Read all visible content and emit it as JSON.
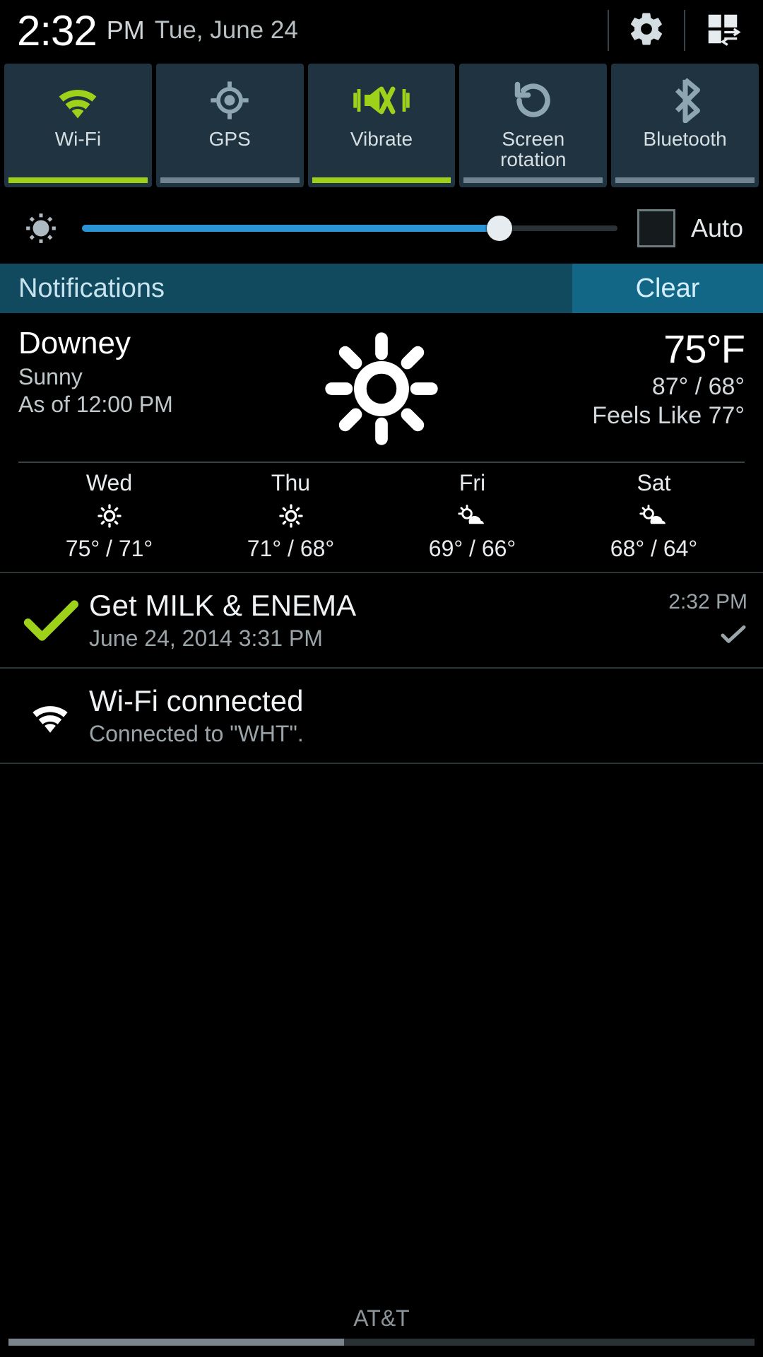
{
  "status": {
    "time": "2:32",
    "ampm": "PM",
    "date": "Tue, June 24"
  },
  "toggles": [
    {
      "label": "Wi-Fi",
      "active": true
    },
    {
      "label": "GPS",
      "active": false
    },
    {
      "label": "Vibrate",
      "active": true
    },
    {
      "label": "Screen\nrotation",
      "active": false
    },
    {
      "label": "Bluetooth",
      "active": false
    }
  ],
  "brightness": {
    "percent": 78,
    "auto_label": "Auto",
    "auto_checked": false
  },
  "notif_header": {
    "title": "Notifications",
    "clear": "Clear"
  },
  "weather": {
    "city": "Downey",
    "condition": "Sunny",
    "asof": "As of 12:00 PM",
    "temp": "75°F",
    "hilo": "87° / 68°",
    "feels": "Feels Like 77°",
    "forecast": [
      {
        "day": "Wed",
        "icon": "sun",
        "temps": "75° / 71°"
      },
      {
        "day": "Thu",
        "icon": "sun",
        "temps": "71° / 68°"
      },
      {
        "day": "Fri",
        "icon": "sun-cloud",
        "temps": "69° / 66°"
      },
      {
        "day": "Sat",
        "icon": "sun-cloud",
        "temps": "68° / 64°"
      }
    ]
  },
  "notifications": [
    {
      "icon": "check-green",
      "title": "Get MILK & ENEMA",
      "subtitle": "June 24, 2014 3:31 PM",
      "time": "2:32 PM",
      "trailing_icon": "check-grey"
    },
    {
      "icon": "wifi-white",
      "title": "Wi-Fi connected",
      "subtitle": "Connected to \"WHT\".",
      "time": "",
      "trailing_icon": ""
    }
  ],
  "footer": {
    "carrier": "AT&T",
    "progress_percent": 45
  },
  "colors": {
    "accent_green": "#9ed11a",
    "accent_blue": "#2a94d6",
    "tile_bg": "#1f3340"
  }
}
